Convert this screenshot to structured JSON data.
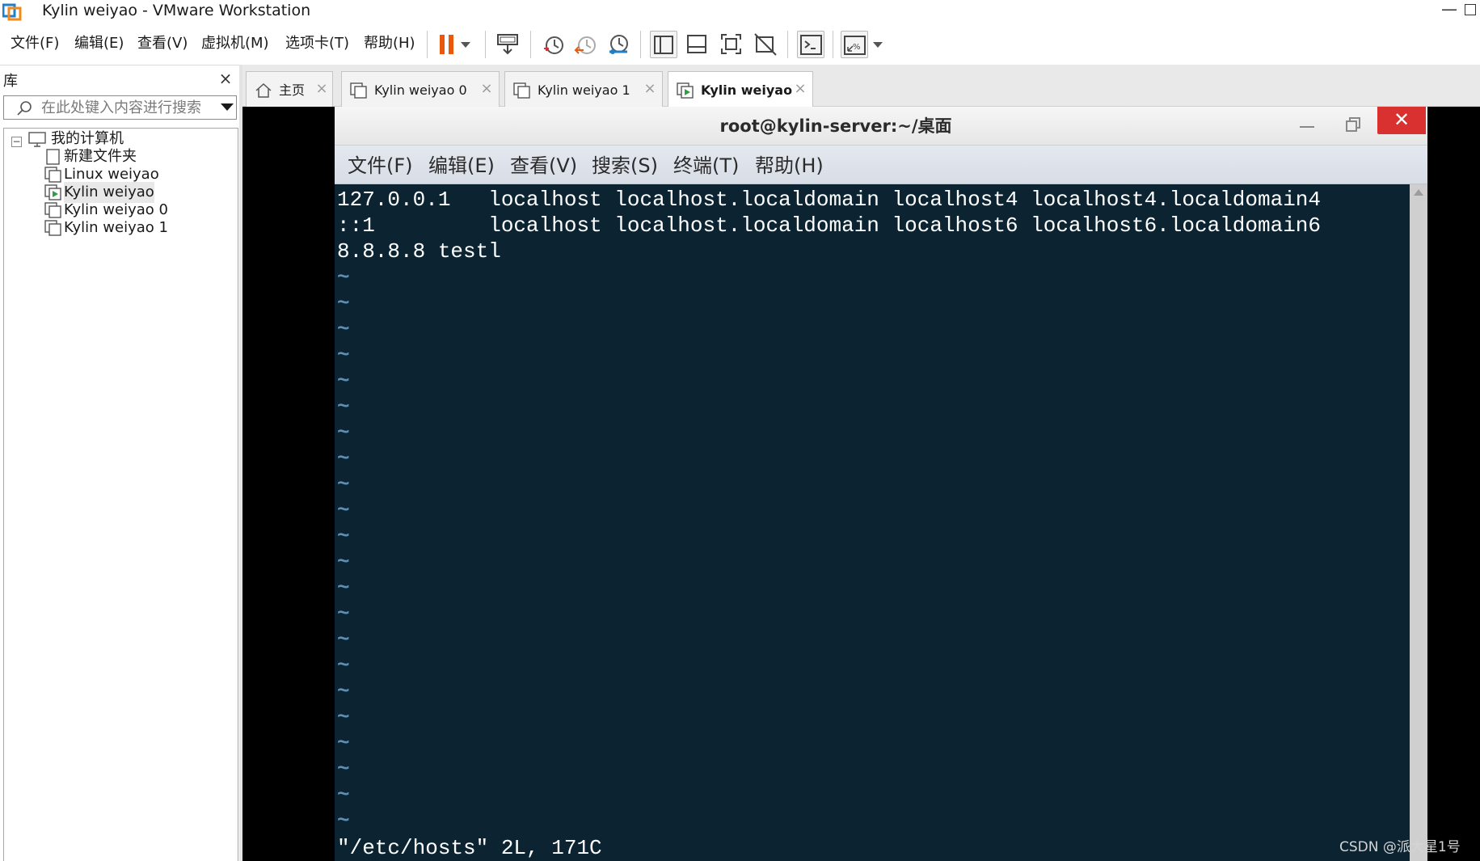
{
  "window": {
    "title": "Kylin weiyao - VMware Workstation",
    "minimize_glyph": "—"
  },
  "menu": {
    "items": [
      "文件(F)",
      "编辑(E)",
      "查看(V)",
      "虚拟机(M)",
      "选项卡(T)",
      "帮助(H)"
    ]
  },
  "toolbar": {
    "icons": [
      "pause-icon",
      "dropdown-arrow-icon",
      "send-ctrl-alt-del-icon",
      "snapshot-icon",
      "revert-snapshot-icon",
      "snapshot-manager-icon",
      "show-library-icon",
      "show-thumbnail-bar-icon",
      "full-screen-icon",
      "unity-icon",
      "console-view-icon",
      "stretch-guest-icon"
    ],
    "accent_color": "#e8590c"
  },
  "library": {
    "title": "库",
    "close_glyph": "×",
    "search_placeholder": "在此处键入内容进行搜索",
    "root_label": "我的计算机",
    "root_expander": "−",
    "items": [
      {
        "label": "新建文件夹",
        "icon": "folder-icon",
        "selected": false
      },
      {
        "label": "Linux weiyao",
        "icon": "vm-icon",
        "selected": false
      },
      {
        "label": "Kylin weiyao",
        "icon": "vm-running-icon",
        "selected": true
      },
      {
        "label": "Kylin weiyao 0",
        "icon": "vm-icon",
        "selected": false
      },
      {
        "label": "Kylin weiyao 1",
        "icon": "vm-icon",
        "selected": false
      }
    ]
  },
  "tabs": [
    {
      "label": "主页",
      "icon": "home-icon",
      "active": false
    },
    {
      "label": "Kylin weiyao 0",
      "icon": "vm-icon",
      "active": false
    },
    {
      "label": "Kylin weiyao 1",
      "icon": "vm-icon",
      "active": false
    },
    {
      "label": "Kylin weiyao",
      "icon": "vm-running-icon",
      "active": true
    }
  ],
  "tab_close_glyph": "×",
  "terminal": {
    "title": "root@kylin-server:~/桌面",
    "close_glyph": "✕",
    "menu": [
      "文件(F)",
      "编辑(E)",
      "查看(V)",
      "搜索(S)",
      "终端(T)",
      "帮助(H)"
    ],
    "lines": [
      "127.0.0.1   localhost localhost.localdomain localhost4 localhost4.localdomain4",
      "::1         localhost localhost.localdomain localhost6 localhost6.localdomain6",
      "8.8.8.8 testl"
    ],
    "tilde_glyph": "~",
    "tilde_count": 22,
    "status_line": "\"/etc/hosts\" 2L, 171C",
    "background": "#0c2432",
    "tilde_color": "#5f8eb2"
  },
  "watermark": "CSDN @派大星1号"
}
